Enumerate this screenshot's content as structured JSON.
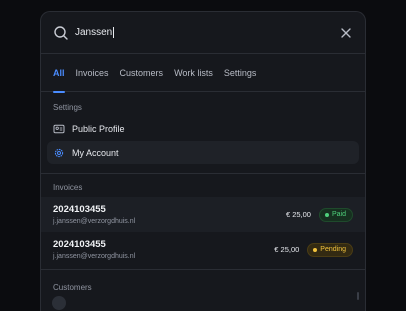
{
  "search": {
    "value": "Janssen",
    "icon": "search-icon",
    "close_icon": "close-icon"
  },
  "tabs": [
    {
      "label": "All",
      "active": true
    },
    {
      "label": "Invoices",
      "active": false
    },
    {
      "label": "Customers",
      "active": false
    },
    {
      "label": "Work lists",
      "active": false
    },
    {
      "label": "Settings",
      "active": false
    }
  ],
  "settings": {
    "heading": "Settings",
    "items": [
      {
        "label": "Public Profile",
        "icon": "id-card-icon"
      },
      {
        "label": "My Account",
        "icon": "settings-gear-icon"
      }
    ]
  },
  "invoices": {
    "heading": "Invoices",
    "items": [
      {
        "number": "2024103455",
        "email": "j.janssen@verzorgdhuis.nl",
        "amount": "€ 25,00",
        "status": "Paid"
      },
      {
        "number": "2024103455",
        "email": "j.janssen@verzorgdhuis.nl",
        "amount": "€ 25,00",
        "status": "Pending"
      }
    ]
  },
  "customers": {
    "heading": "Customers"
  },
  "colors": {
    "accent": "#4a8cff",
    "paid": "#4fd07b",
    "pending": "#f2c33d",
    "panel_bg": "#16181d",
    "page_bg": "#0b0c0f"
  }
}
